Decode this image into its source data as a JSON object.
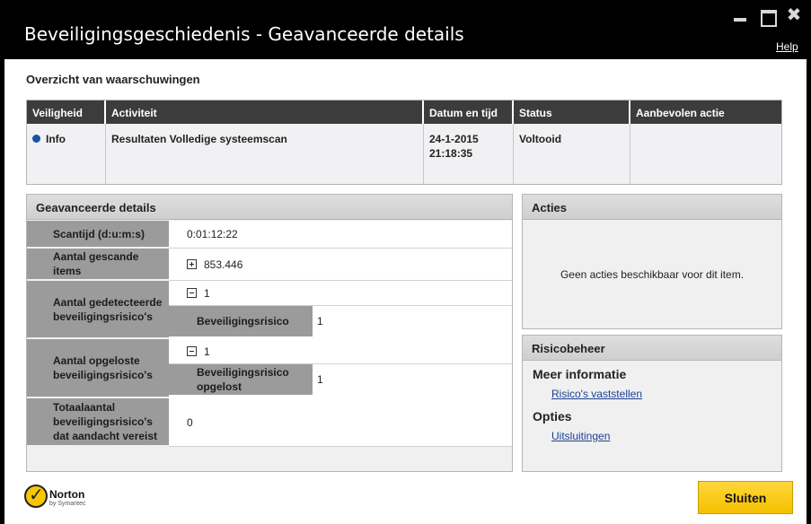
{
  "window": {
    "title": "Beveiligingsgeschiedenis - Geavanceerde details",
    "help": "Help",
    "minimize_icon": "minimize-icon",
    "maximize_icon": "maximize-icon",
    "close_icon": "close-icon",
    "close_glyph": "✖"
  },
  "overview": {
    "heading": "Overzicht van waarschuwingen",
    "columns": [
      "Veiligheid",
      "Activiteit",
      "Datum en tijd",
      "Status",
      "Aanbevolen actie"
    ],
    "row": {
      "severity": "Info",
      "activity": "Resultaten Volledige systeemscan",
      "date": "24-1-2015",
      "time": "21:18:35",
      "status": "Voltooid",
      "action": ""
    },
    "severity_color": "#1e4ea8"
  },
  "details": {
    "heading": "Geavanceerde details",
    "scan_time_label": "Scantijd (d:u:m:s)",
    "scan_time_value": "0:01:12:22",
    "scanned_items_label": "Aantal gescande items",
    "scanned_items_value": "853.446",
    "detected_label": "Aantal gedetecteerde beveiligingsrisico's",
    "detected_value": "1",
    "detected_sub_label": "Beveiligingsrisico",
    "detected_sub_value": "1",
    "resolved_label": "Aantal opgeloste beveiligingsrisico's",
    "resolved_value": "1",
    "resolved_sub_label": "Beveiligingsrisico opgelost",
    "resolved_sub_value": "1",
    "attention_label": "Totaalaantal beveiligingsrisico's dat aandacht vereist",
    "attention_value": "0"
  },
  "actions": {
    "heading": "Acties",
    "empty_text": "Geen acties beschikbaar voor dit item."
  },
  "risk": {
    "heading": "Risicobeheer",
    "more_info": "Meer informatie",
    "more_info_link": "Risico's vaststellen",
    "options": "Opties",
    "options_link": "Uitsluitingen"
  },
  "footer": {
    "brand": "Norton",
    "brand_sub": "by Symantec",
    "close_button": "Sluiten",
    "accent": "#f5c000"
  }
}
